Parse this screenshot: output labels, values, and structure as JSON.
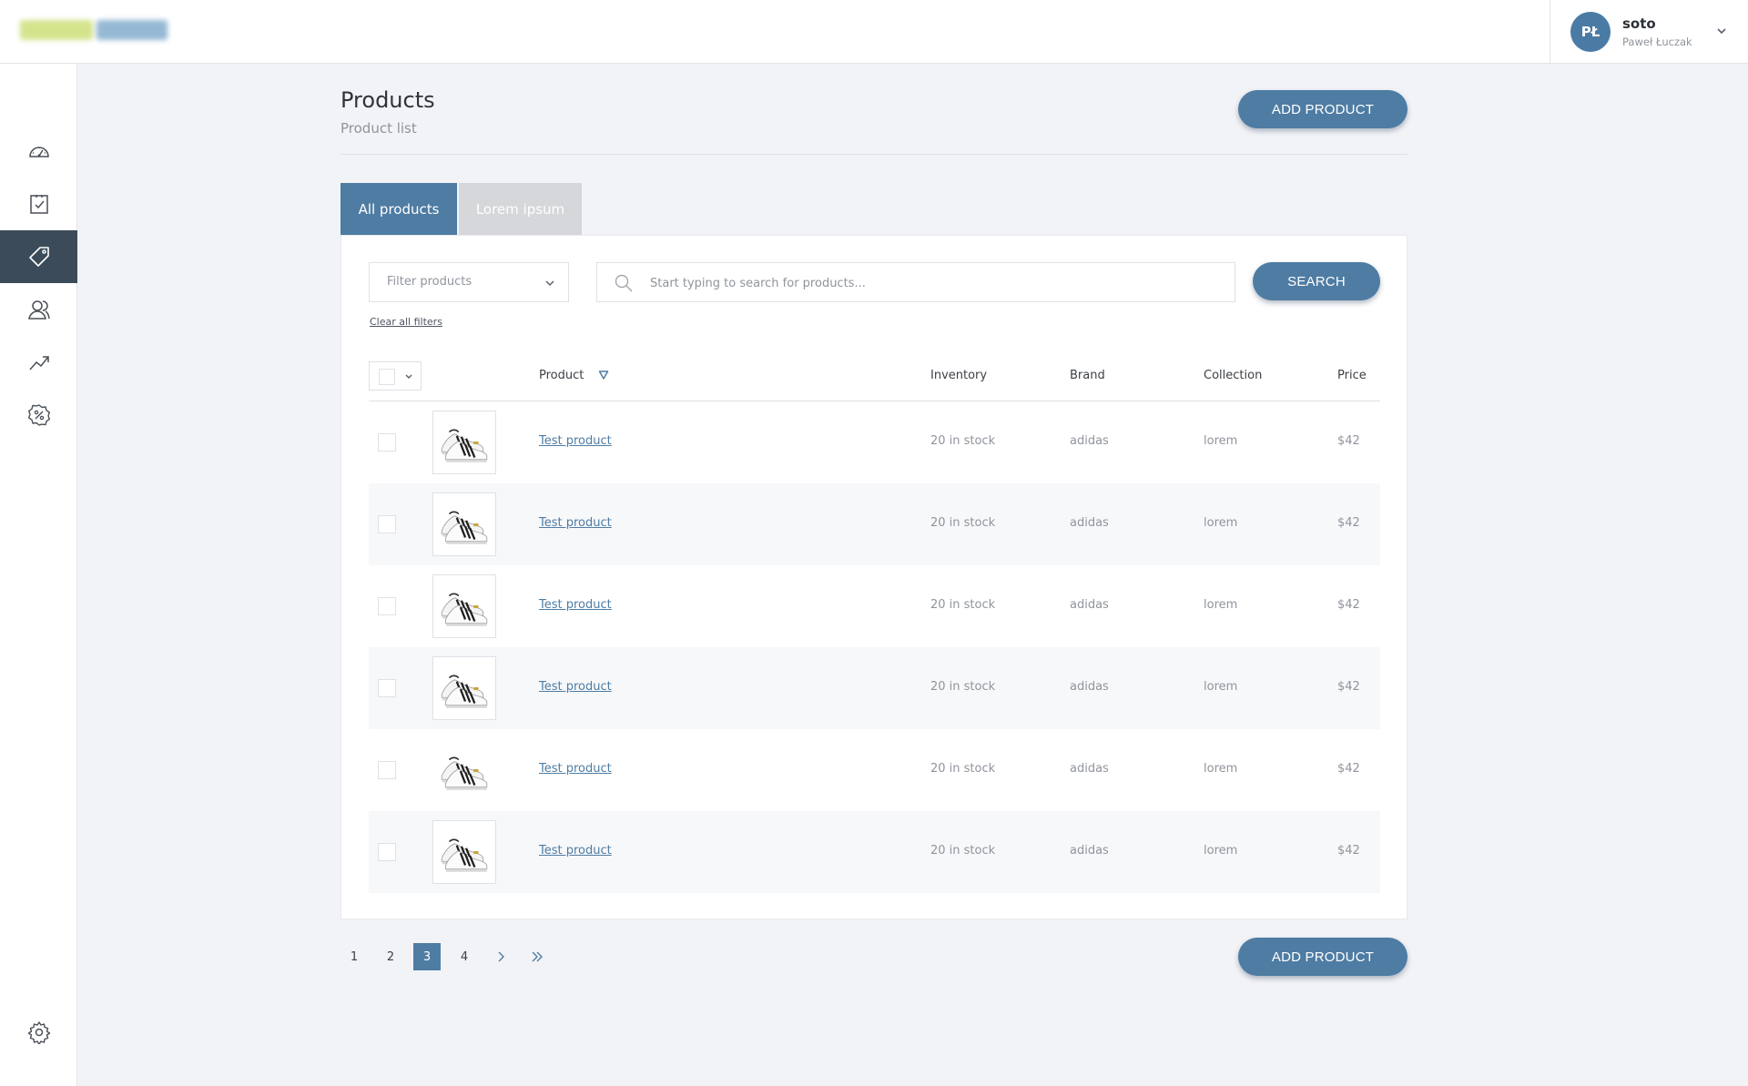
{
  "header": {
    "user": {
      "initials": "PŁ",
      "username": "soto",
      "full_name": "Paweł Łuczak"
    }
  },
  "sidebar": {
    "items": [
      {
        "icon": "dashboard-icon",
        "active": false
      },
      {
        "icon": "tasks-icon",
        "active": false
      },
      {
        "icon": "tag-icon",
        "active": true
      },
      {
        "icon": "customers-icon",
        "active": false
      },
      {
        "icon": "analytics-icon",
        "active": false
      },
      {
        "icon": "discount-icon",
        "active": false
      }
    ],
    "settings_icon": "gear-icon"
  },
  "page": {
    "title": "Products",
    "subtitle": "Product list",
    "add_button": "ADD PRODUCT",
    "add_button_bottom": "ADD PRODUCT"
  },
  "tabs": [
    {
      "label": "All products",
      "active": true
    },
    {
      "label": "Lorem ipsum",
      "active": false
    }
  ],
  "filters": {
    "filter_placeholder": "Filter products",
    "search_placeholder": "Start typing to search for products...",
    "search_button": "SEARCH",
    "clear_label": "Clear all filters"
  },
  "table": {
    "columns": {
      "product": "Product",
      "inventory": "Inventory",
      "brand": "Brand",
      "collection": "Collection",
      "price": "Price"
    },
    "rows": [
      {
        "name": "Test product",
        "inventory": "20 in stock",
        "brand": "adidas",
        "collection": "lorem",
        "price": "$42"
      },
      {
        "name": "Test product",
        "inventory": "20 in stock",
        "brand": "adidas",
        "collection": "lorem",
        "price": "$42"
      },
      {
        "name": "Test product",
        "inventory": "20 in stock",
        "brand": "adidas",
        "collection": "lorem",
        "price": "$42"
      },
      {
        "name": "Test product",
        "inventory": "20 in stock",
        "brand": "adidas",
        "collection": "lorem",
        "price": "$42"
      },
      {
        "name": "Test product",
        "inventory": "20 in stock",
        "brand": "adidas",
        "collection": "lorem",
        "price": "$42"
      },
      {
        "name": "Test product",
        "inventory": "20 in stock",
        "brand": "adidas",
        "collection": "lorem",
        "price": "$42"
      }
    ]
  },
  "pagination": {
    "pages": [
      "1",
      "2",
      "3",
      "4"
    ],
    "current": "3"
  },
  "colors": {
    "accent": "#4e7ca3",
    "sidebar_active": "#3c4b5a",
    "tab_inactive": "#d6d7da"
  }
}
